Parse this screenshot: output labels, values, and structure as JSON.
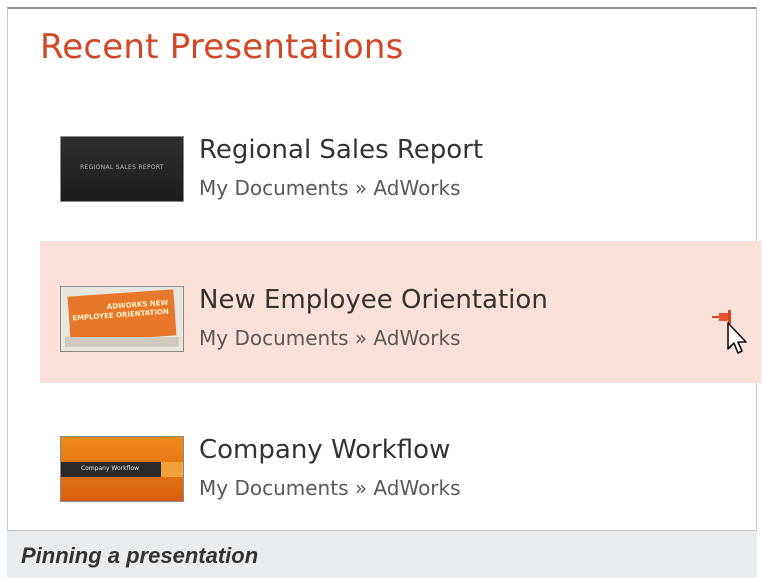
{
  "panel": {
    "heading": "Recent Presentations",
    "accent_color": "#d24726",
    "highlight_color": "#fbe1da"
  },
  "recent": [
    {
      "title": "Regional Sales Report",
      "path": "My Documents » AdWorks",
      "thumbnail_text": [
        "REGIONAL SALES REPORT"
      ],
      "pinned_hover": false
    },
    {
      "title": "New Employee Orientation",
      "path": "My Documents » AdWorks",
      "thumbnail_text": [
        "ADWORKS NEW",
        "EMPLOYEE ORIENTATION"
      ],
      "pinned_hover": true,
      "pin_icon": "pin-icon",
      "cursor_icon": "mouse-pointer-icon"
    },
    {
      "title": "Company Workflow",
      "path": "My Documents » AdWorks",
      "thumbnail_text": [
        "Company Workflow"
      ],
      "pinned_hover": false
    }
  ],
  "caption": "Pinning a presentation"
}
